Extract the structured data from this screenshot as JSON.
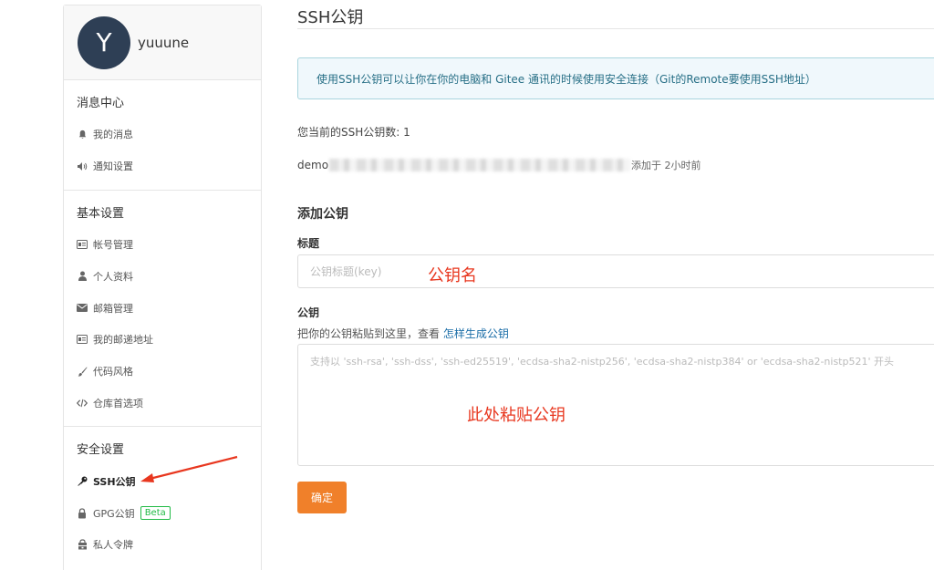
{
  "sidebar": {
    "avatar_letter": "Y",
    "username": "yuuune",
    "sections": [
      {
        "title": "消息中心",
        "items": [
          {
            "label": "我的消息",
            "icon": "bell-icon"
          },
          {
            "label": "通知设置",
            "icon": "speaker-icon"
          }
        ]
      },
      {
        "title": "基本设置",
        "items": [
          {
            "label": "帐号管理",
            "icon": "id-card-icon"
          },
          {
            "label": "个人资料",
            "icon": "user-icon"
          },
          {
            "label": "邮箱管理",
            "icon": "envelope-icon"
          },
          {
            "label": "我的邮递地址",
            "icon": "address-card-icon"
          },
          {
            "label": "代码风格",
            "icon": "brush-icon"
          },
          {
            "label": "仓库首选项",
            "icon": "code-icon"
          }
        ]
      },
      {
        "title": "安全设置",
        "items": [
          {
            "label": "SSH公钥",
            "icon": "key-icon",
            "active": true
          },
          {
            "label": "GPG公钥",
            "icon": "lock-icon",
            "badge": "Beta"
          },
          {
            "label": "私人令牌",
            "icon": "token-icon"
          }
        ]
      }
    ]
  },
  "main": {
    "title": "SSH公钥",
    "info": "使用SSH公钥可以让你在你的电脑和 Gitee 通讯的时候使用安全连接（Git的Remote要使用SSH地址）",
    "count_text": "您当前的SSH公钥数: 1",
    "key_name_prefix": "demo",
    "key_added": "添加于 2小时前",
    "add_heading": "添加公钥",
    "title_label": "标题",
    "title_placeholder": "公钥标题(key)",
    "key_label": "公钥",
    "key_help_prefix": "把你的公钥粘贴到这里，查看",
    "key_help_link": "怎样生成公钥",
    "key_placeholder": "支持以 'ssh-rsa', 'ssh-dss', 'ssh-ed25519', 'ecdsa-sha2-nistp256', 'ecdsa-sha2-nistp384' or 'ecdsa-sha2-nistp521' 开头",
    "confirm_label": "确定"
  },
  "annotations": {
    "title_hint": "公钥名",
    "key_hint": "此处粘贴公钥",
    "color": "#e8371f"
  },
  "colors": {
    "accent": "#f0802a",
    "info_bg": "#f0f8fc",
    "info_text": "#276f86",
    "beta": "#21ba45",
    "avatar_bg": "#2e3f55"
  }
}
